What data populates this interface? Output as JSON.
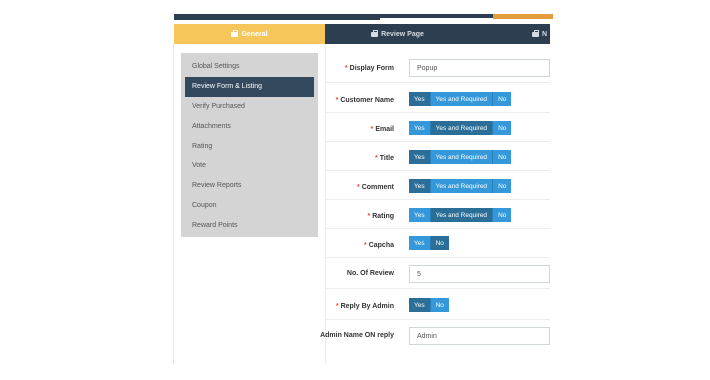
{
  "tabs": [
    {
      "label": "General",
      "icon": "briefcase-icon"
    },
    {
      "label": "Review Page",
      "icon": "briefcase-icon"
    },
    {
      "label": "N",
      "icon": "briefcase-icon"
    }
  ],
  "sidebar": {
    "items": [
      {
        "label": "Global Settings"
      },
      {
        "label": "Review Form & Listing",
        "active": true
      },
      {
        "label": "Verify Purchased"
      },
      {
        "label": "Attachments"
      },
      {
        "label": "Rating"
      },
      {
        "label": "Vote"
      },
      {
        "label": "Review Reports"
      },
      {
        "label": "Coupon"
      },
      {
        "label": "Reward Points"
      }
    ]
  },
  "form": {
    "display_form": {
      "label": "Display Form",
      "required": "*",
      "value": "Popup"
    },
    "customer_name": {
      "label": "Customer Name",
      "required": "*",
      "options": [
        "Yes",
        "Yes and Required",
        "No"
      ]
    },
    "email": {
      "label": "Email",
      "required": "*",
      "options": [
        "Yes",
        "Yes and Required",
        "No"
      ]
    },
    "title": {
      "label": "Title",
      "required": "*",
      "options": [
        "Yes",
        "Yes and Required",
        "No"
      ]
    },
    "comment": {
      "label": "Comment",
      "required": "*",
      "options": [
        "Yes",
        "Yes and Required",
        "No"
      ]
    },
    "rating": {
      "label": "Rating",
      "required": "*",
      "options": [
        "Yes",
        "Yes and Required",
        "No"
      ]
    },
    "capcha": {
      "label": "Capcha",
      "required": "*",
      "options": [
        "Yes",
        "No"
      ]
    },
    "no_of_review": {
      "label": "No. Of Review",
      "value": "5"
    },
    "reply_by_admin": {
      "label": "Reply By Admin",
      "required": "*",
      "options": [
        "Yes",
        "No"
      ]
    },
    "admin_name": {
      "label": "Admin Name ON reply",
      "value": "Admin"
    }
  },
  "colors": {
    "accent_yellow": "#f6c65a",
    "nav_dark": "#2c3e50",
    "toggle_blue": "#3498db",
    "toggle_active": "#2b6f99",
    "required_red": "#e74c3c"
  }
}
